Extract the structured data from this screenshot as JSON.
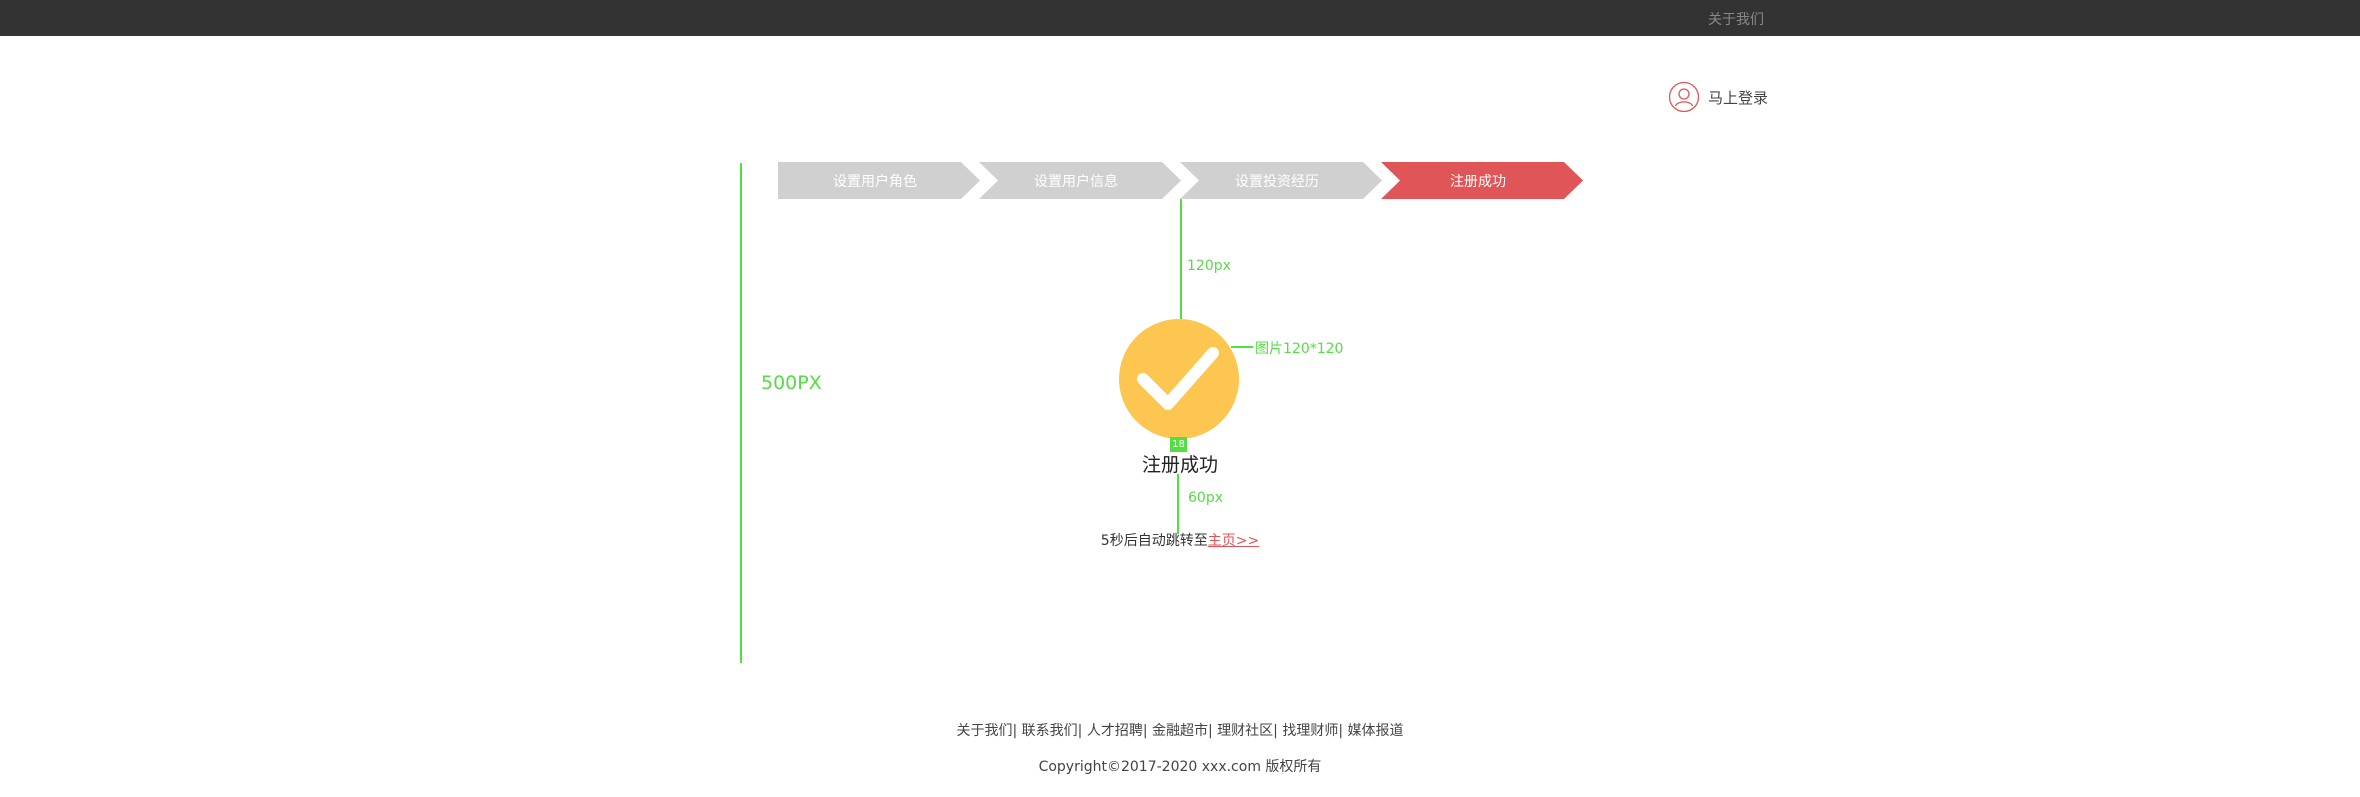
{
  "topbar": {
    "about_link": "关于我们"
  },
  "header": {
    "login_label": "马上登录",
    "login_icon": "user-icon"
  },
  "steps": [
    {
      "label": "设置用户角色",
      "active": false
    },
    {
      "label": "设置用户信息",
      "active": false
    },
    {
      "label": "设置投资经历",
      "active": false
    },
    {
      "label": "注册成功",
      "active": true
    }
  ],
  "annotations": {
    "height_label": "500PX",
    "top_gap_label": "120px",
    "image_size_label": "图片120*120",
    "gap_badge": "18",
    "bottom_gap_label": "60px"
  },
  "success": {
    "icon": "check-circle-icon",
    "title": "注册成功",
    "redirect_text": "5秒后自动跳转至",
    "home_link": "主页>>"
  },
  "footer": {
    "links": [
      "关于我们",
      "联系我们",
      "人才招聘",
      "金融超市",
      "理财社区",
      "找理财师",
      "媒体报道"
    ],
    "copyright": "Copyright©2017-2020  xxx.com 版权所有"
  },
  "colors": {
    "topbar": "#333333",
    "accent": "#e05557",
    "step_inactive": "#d0d0d0",
    "success_icon": "#fcc651",
    "annotation": "#55dd44"
  }
}
